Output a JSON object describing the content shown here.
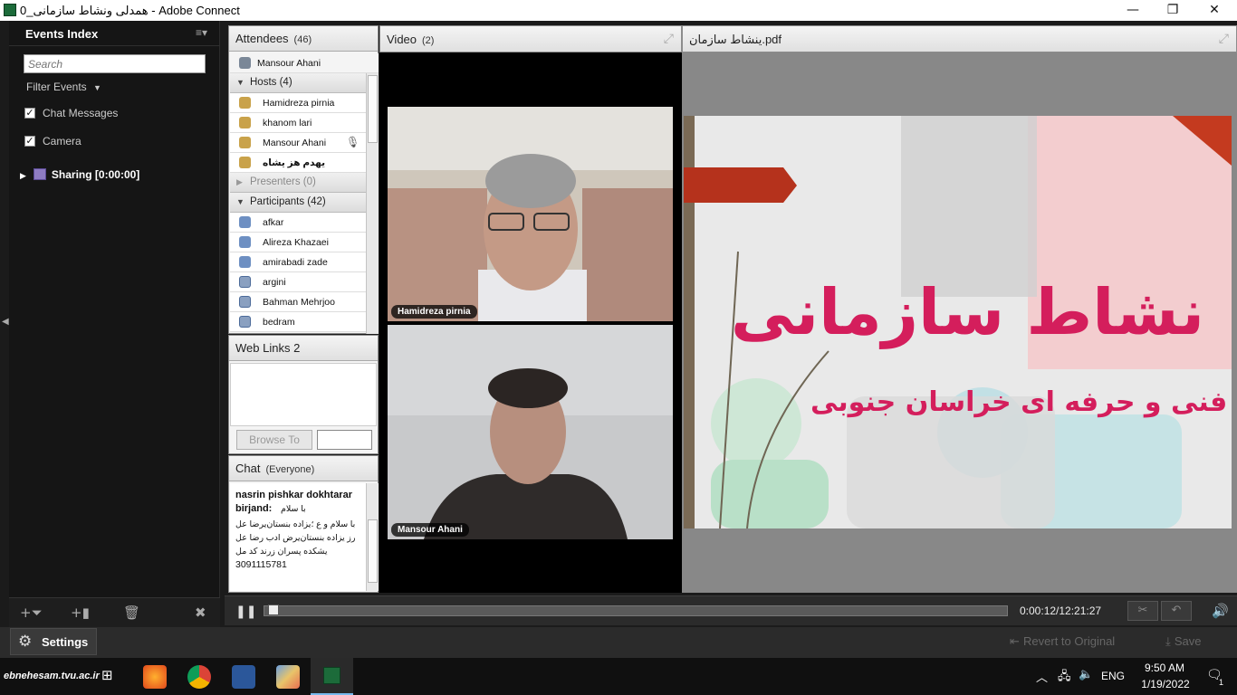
{
  "window": {
    "title": "همدلی ونشاط سازمانی_0 - Adobe Connect",
    "controls": {
      "minimize": "—",
      "restore": "❐",
      "close": "✕"
    }
  },
  "events_panel": {
    "title": "Events Index",
    "menu_icon": "≡▾",
    "search_placeholder": "Search",
    "filter_label": "Filter Events",
    "filters": [
      {
        "label": "Chat Messages",
        "checked": true
      },
      {
        "label": "Camera",
        "checked": true
      }
    ],
    "sharing_label": "Sharing [0:00:00]"
  },
  "attendees": {
    "title": "Attendees",
    "count": "(46)",
    "current_user": "Mansour Ahani",
    "hosts_label": "Hosts (4)",
    "hosts": [
      "Hamidreza pirnia",
      "khanom lari",
      "Mansour Ahani",
      "یهدم هز یشاه"
    ],
    "presenters_label": "Presenters (0)",
    "participants_label": "Participants (42)",
    "participants": [
      "afkar",
      "Alireza Khazaei",
      "amirabadi zade",
      "argini",
      "Bahman Mehrjoo",
      "bedram"
    ]
  },
  "web_links": {
    "title": "Web Links 2",
    "browse_button": "Browse To"
  },
  "chat": {
    "title": "Chat",
    "scope": "(Everyone)",
    "sender": "nasrin pishkar dokhtarar birjand:",
    "greeting": "با سلام",
    "lines": [
      "با سلام و ع ؛یزاده بنستان‌یرضا عل",
      "رز یزاده بنستان‌یرض ادب رضا عل",
      "یشکده پسران زرند کد مل",
      "3091115781"
    ]
  },
  "video": {
    "title": "Video",
    "count": "(2)",
    "feeds": [
      {
        "name": "Hamidreza pirnia"
      },
      {
        "name": "Mansour Ahani"
      }
    ]
  },
  "share": {
    "title": "ینشاط سازمان.pdf",
    "slide_title": "نشاط سازمانی",
    "slide_subtitle": "گاه فنی و حرفه ای خراسان جنوبی"
  },
  "playbar": {
    "timecode": "0:00:12/12:21:27",
    "progress_fraction": 0.0003
  },
  "bottom_bar": {
    "settings": "Settings",
    "revert": "Revert to Original",
    "save": "Save"
  },
  "taskbar": {
    "watermark": "ebnehesam.tvu.ac.ir",
    "language": "ENG",
    "time": "9:50 AM",
    "date": "1/19/2022",
    "notification_count": "1"
  }
}
